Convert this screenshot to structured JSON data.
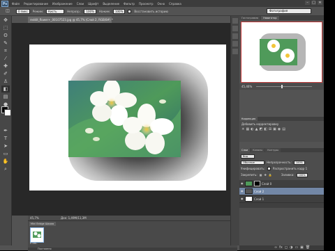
{
  "app": {
    "logo": "Ps",
    "menu": [
      "Файл",
      "Редактирование",
      "Изображение",
      "Слои",
      "Шрифт",
      "Выделение",
      "Фильтр",
      "Просмотр",
      "Окно",
      "Справка"
    ],
    "window_controls": [
      "–",
      "□",
      "✕"
    ]
  },
  "options_bar": {
    "feather_value": "0 пикс",
    "mode_label": "Режим:",
    "mode_value": "Кисть",
    "opacity_label": "Непрозр.:",
    "opacity_value": "100%",
    "pressure_label": "Нажим:",
    "pressure_value": "100%",
    "erase_history_label": "Восстановить историю",
    "workspace_value": "Фотография"
  },
  "document": {
    "tab_title": "reddit_flower+_00107523.jpg @ 45,7% (Слой 2, RGB/8#) *",
    "zoom": "45,7%",
    "doc_info": "Док: 1,49М/11,3М"
  },
  "mini_bridge": {
    "tab_label": "Mini Bridge  Шкала времени",
    "thumb_label": "0 сек.",
    "bottom_text": "Постоянно"
  },
  "navigator": {
    "tabs": [
      "Гистограмма",
      "Навигатор"
    ],
    "active_tab": 1,
    "zoom": "45,46%"
  },
  "corrections": {
    "tab": "Коррекция",
    "title": "Добавить корректировку",
    "icons": [
      "☀",
      "▦",
      "◐",
      "▲",
      "◩",
      "◧",
      "⊞",
      "▣",
      "◉",
      "▤"
    ]
  },
  "layers": {
    "tabs": [
      "Слои",
      "Каналы",
      "Контуры"
    ],
    "active_tab": 0,
    "filter_label": "Вид",
    "blend_mode": "Обычные",
    "opacity_label": "Непрозрачность:",
    "opacity_value": "100%",
    "lock_label": "Закрепить:",
    "fill_label": "Заливка:",
    "fill_value": "100%",
    "propagate_label": "Распространить кадр 1",
    "unify_label": "Унифицировать:",
    "items": [
      {
        "name": "Слой 0",
        "selected": false,
        "has_mask": true
      },
      {
        "name": "Слой 2",
        "selected": true,
        "has_mask": false
      },
      {
        "name": "Слой 1",
        "selected": false,
        "has_mask": false
      }
    ],
    "footer_icons": [
      "∞",
      "fx",
      "◻",
      "◑",
      "▭",
      "▣",
      "🗑"
    ]
  }
}
